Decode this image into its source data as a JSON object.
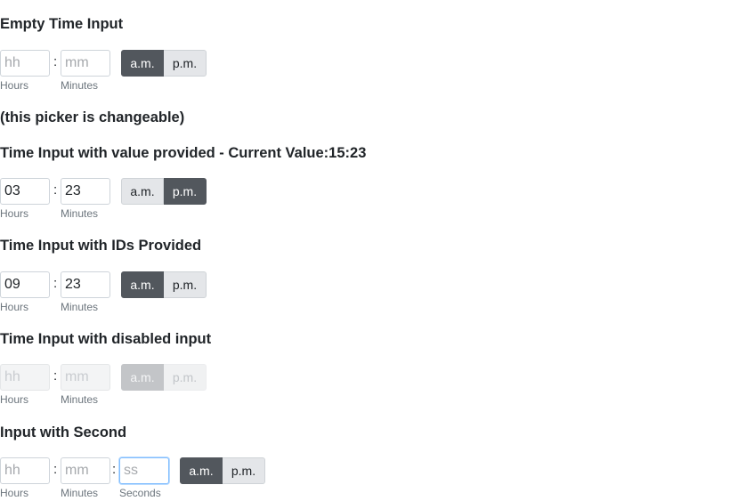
{
  "sections": [
    {
      "title": "Empty Time Input",
      "hours": {
        "value": "",
        "placeholder": "hh",
        "label": "Hours"
      },
      "minutes": {
        "value": "",
        "placeholder": "mm",
        "label": "Minutes"
      },
      "am_label": "a.m.",
      "pm_label": "p.m.",
      "selected": "am",
      "note": "(this picker is changeable)"
    },
    {
      "title": "Time Input with value provided - Current Value:15:23",
      "hours": {
        "value": "03",
        "placeholder": "hh",
        "label": "Hours"
      },
      "minutes": {
        "value": "23",
        "placeholder": "mm",
        "label": "Minutes"
      },
      "am_label": "a.m.",
      "pm_label": "p.m.",
      "selected": "pm"
    },
    {
      "title": "Time Input with IDs Provided",
      "hours": {
        "value": "09",
        "placeholder": "hh",
        "label": "Hours"
      },
      "minutes": {
        "value": "23",
        "placeholder": "mm",
        "label": "Minutes"
      },
      "am_label": "a.m.",
      "pm_label": "p.m.",
      "selected": "am"
    },
    {
      "title": "Time Input with disabled input",
      "hours": {
        "value": "",
        "placeholder": "hh",
        "label": "Hours"
      },
      "minutes": {
        "value": "",
        "placeholder": "mm",
        "label": "Minutes"
      },
      "am_label": "a.m.",
      "pm_label": "p.m.",
      "selected": "am",
      "disabled": true
    },
    {
      "title": "Input with Second",
      "hours": {
        "value": "",
        "placeholder": "hh",
        "label": "Hours"
      },
      "minutes": {
        "value": "",
        "placeholder": "mm",
        "label": "Minutes"
      },
      "seconds": {
        "value": "",
        "placeholder": "ss",
        "label": "Seconds"
      },
      "am_label": "a.m.",
      "pm_label": "p.m.",
      "selected": "am"
    }
  ],
  "separator": ":",
  "colors": {
    "active_button": "#52575d",
    "inactive_button": "#e4e6e9",
    "focus_border": "#80bdff"
  }
}
